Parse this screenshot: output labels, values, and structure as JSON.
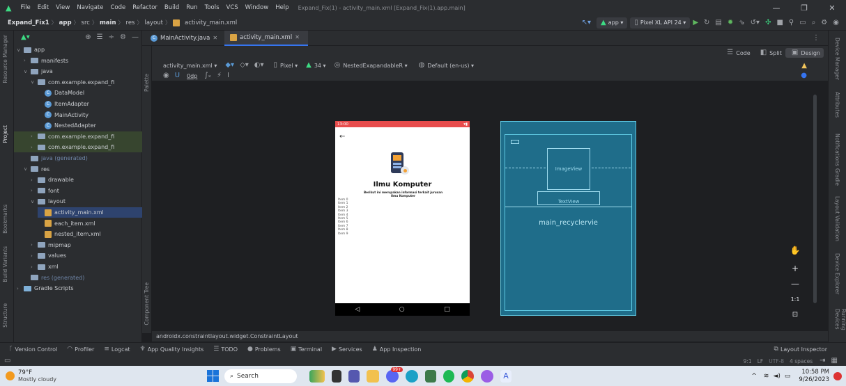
{
  "menu": [
    "File",
    "Edit",
    "View",
    "Navigate",
    "Code",
    "Refactor",
    "Build",
    "Run",
    "Tools",
    "VCS",
    "Window",
    "Help"
  ],
  "window_title": "Expand_Fix(1) - activity_main.xml [Expand_Fix(1).app.main]",
  "breadcrumb": [
    "Expand_Fix1",
    "app",
    "src",
    "main",
    "res",
    "layout",
    "activity_main.xml"
  ],
  "toolbar": {
    "run_config": "app",
    "device": "Pixel XL API 24"
  },
  "editor_tabs": [
    "MainActivity.java",
    "activity_main.xml"
  ],
  "view_modes": [
    "Code",
    "Split",
    "Design"
  ],
  "design_toolbar": {
    "file": "activity_main.xml",
    "device": "Pixel",
    "api": "34",
    "theme": "NestedExapandableR",
    "locale": "Default (en-us)",
    "margin": "0dp"
  },
  "left_strip": [
    "Resource Manager",
    "Project",
    "Bookmarks",
    "Build Variants",
    "Structure"
  ],
  "tree": [
    {
      "label": "app",
      "indent": 0,
      "type": "folder",
      "arrow": "v"
    },
    {
      "label": "manifests",
      "indent": 1,
      "type": "folder",
      "arrow": ">"
    },
    {
      "label": "java",
      "indent": 1,
      "type": "folder",
      "arrow": "v"
    },
    {
      "label": "com.example.expand_fi",
      "indent": 2,
      "type": "folder",
      "arrow": "v"
    },
    {
      "label": "DataModel",
      "indent": 3,
      "type": "class",
      "arrow": ""
    },
    {
      "label": "ItemAdapter",
      "indent": 3,
      "type": "class",
      "arrow": ""
    },
    {
      "label": "MainActivity",
      "indent": 3,
      "type": "class",
      "arrow": ""
    },
    {
      "label": "NestedAdapter",
      "indent": 3,
      "type": "class",
      "arrow": ""
    },
    {
      "label": "com.example.expand_fi",
      "indent": 2,
      "type": "folder",
      "arrow": ">"
    },
    {
      "label": "com.example.expand_fi",
      "indent": 2,
      "type": "folder",
      "arrow": ">"
    },
    {
      "label": "java (generated)",
      "indent": 1,
      "type": "gen",
      "arrow": ""
    },
    {
      "label": "res",
      "indent": 1,
      "type": "folder",
      "arrow": "v"
    },
    {
      "label": "drawable",
      "indent": 2,
      "type": "folder",
      "arrow": ">"
    },
    {
      "label": "font",
      "indent": 2,
      "type": "folder",
      "arrow": ">"
    },
    {
      "label": "layout",
      "indent": 2,
      "type": "folder",
      "arrow": "v"
    },
    {
      "label": "activity_main.xml",
      "indent": 3,
      "type": "xml",
      "arrow": ""
    },
    {
      "label": "each_item.xml",
      "indent": 3,
      "type": "xml",
      "arrow": ""
    },
    {
      "label": "nested_item.xml",
      "indent": 3,
      "type": "xml",
      "arrow": ""
    },
    {
      "label": "mipmap",
      "indent": 2,
      "type": "folder",
      "arrow": ">"
    },
    {
      "label": "values",
      "indent": 2,
      "type": "folder",
      "arrow": ">"
    },
    {
      "label": "xml",
      "indent": 2,
      "type": "folder",
      "arrow": ">"
    },
    {
      "label": "res (generated)",
      "indent": 1,
      "type": "gen",
      "arrow": ""
    },
    {
      "label": "Gradle Scripts",
      "indent": 0,
      "type": "gradle",
      "arrow": ">"
    }
  ],
  "palette_labels": [
    "Palette",
    "Component Tree"
  ],
  "phone": {
    "time": "13:00",
    "title": "Ilmu Komputer",
    "subtitle": "Berikut ini merupakan informasi terkait jurusan Ilmu Komputer",
    "items": [
      "Item 0",
      "Item 1",
      "Item 2",
      "Item 3",
      "Item 4",
      "Item 5",
      "Item 6",
      "Item 7",
      "Item 8",
      "Item 9"
    ]
  },
  "blueprint": {
    "image_label": "ImageView",
    "text_label": "TextView",
    "recycler_label": "main_recyclervie"
  },
  "zoom": {
    "ratio": "1:1"
  },
  "component_path": "androidx.constraintlayout.widget.ConstraintLayout",
  "right_strip": [
    "Device Manager",
    "Attributes",
    "Notifications",
    "Gradle",
    "Layout Validation",
    "Device Explorer",
    "Running Devices"
  ],
  "bottom_tabs": [
    "Version Control",
    "Profiler",
    "Logcat",
    "App Quality Insights",
    "TODO",
    "Problems",
    "Terminal",
    "Services",
    "App Inspection"
  ],
  "layout_inspector": "Layout Inspector",
  "status": {
    "position": "9:1",
    "line_sep": "LF",
    "encoding": "UTF-8",
    "indent": "4 spaces"
  },
  "taskbar": {
    "weather_temp": "79°F",
    "weather_desc": "Mostly cloudy",
    "search": "Search",
    "time": "10:58 PM",
    "date": "9/26/2023",
    "badge": "99+"
  }
}
